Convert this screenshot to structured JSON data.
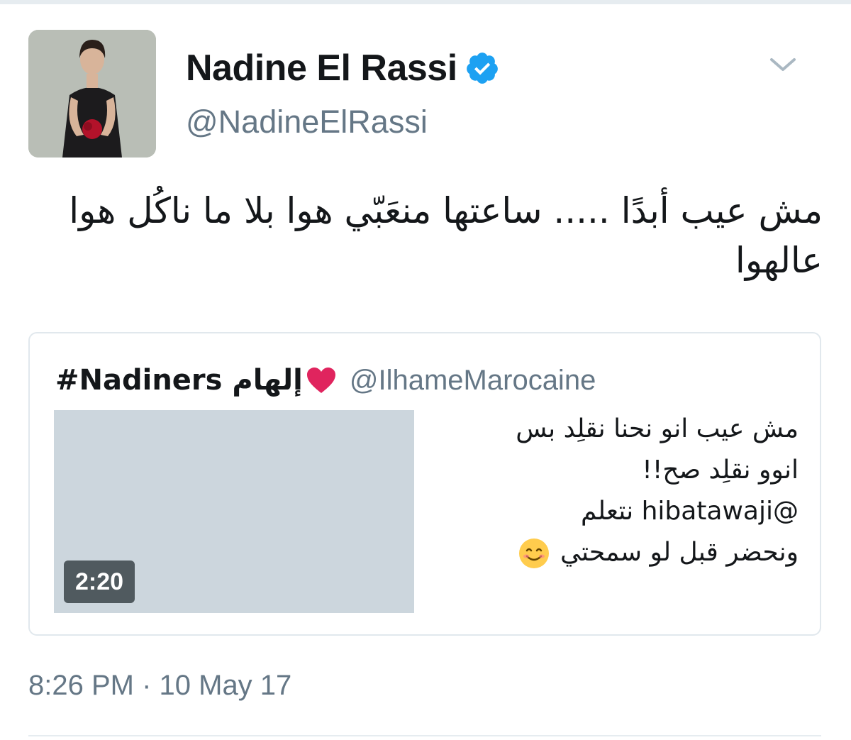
{
  "tweet": {
    "author": {
      "display_name": "Nadine El Rassi",
      "handle": "@NadineElRassi",
      "verified": true,
      "verified_color": "#1da1f2",
      "avatar_icon": "profile-photo"
    },
    "menu_icon": "chevron-down-icon",
    "text": "مش عيب أبدًا ..... ساعتها منعَبّي هوا بلا ما ناكُل هوا عالهوا",
    "timestamp": "8:26 PM · 10 May 17"
  },
  "quoted_tweet": {
    "display_name": "#Nadiners إلهام",
    "emoji_icon": "heart-icon",
    "handle": "@IlhameMarocaine",
    "video_duration": "2:20",
    "text_lines": [
      "مش عيب انو نحنا نقلِد بس",
      "انوو نقلِد صح!!",
      "@hibatawaji نتعلم",
      "ونحضر قبل لو سمحتي"
    ],
    "trailing_emoji_icon": "smiling-face-icon",
    "thumbnail_color": "#ccd6dd"
  },
  "colors": {
    "secondary_text": "#657786",
    "border": "#e1e8ed",
    "heart": "#e0245e"
  }
}
